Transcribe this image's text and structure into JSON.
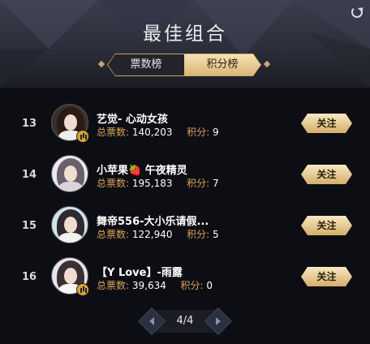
{
  "header": {
    "title": "最佳组合"
  },
  "tabs": [
    {
      "label": "票数榜",
      "active": false
    },
    {
      "label": "积分榜",
      "active": true
    }
  ],
  "entries": [
    {
      "rank": "13",
      "name": "艺觉- 心动女孩",
      "votes_label": "总票数:",
      "votes": "140,203",
      "points_label": "积分:",
      "points": "9",
      "follow_label": "关注",
      "has_badge": true
    },
    {
      "rank": "14",
      "name": "小苹果🍓 午夜精灵",
      "votes_label": "总票数:",
      "votes": "195,183",
      "points_label": "积分:",
      "points": "7",
      "follow_label": "关注",
      "has_badge": false
    },
    {
      "rank": "15",
      "name": "舞帝556-大小乐请假...",
      "votes_label": "总票数:",
      "votes": "122,940",
      "points_label": "积分:",
      "points": "5",
      "follow_label": "关注",
      "has_badge": false
    },
    {
      "rank": "16",
      "name": "【Y Love】-雨露",
      "votes_label": "总票数:",
      "votes": "39,634",
      "points_label": "积分:",
      "points": "0",
      "follow_label": "关注",
      "has_badge": true
    }
  ],
  "pager": {
    "label": "4/4"
  },
  "colors": {
    "accent_gold": "#d9a35a",
    "button_gold": "#e8c98a",
    "background": "#0d0d14"
  }
}
